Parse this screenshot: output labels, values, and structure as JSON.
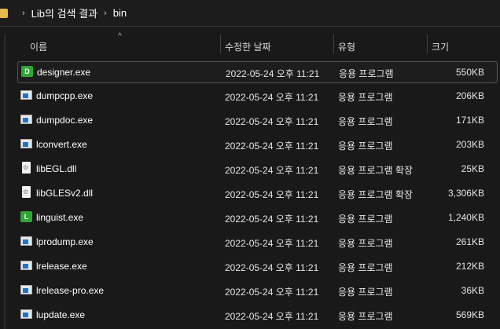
{
  "breadcrumb": [
    "Lib의 검색 결과",
    "bin"
  ],
  "columns": {
    "name": "이름",
    "date": "수정한 날짜",
    "type": "유형",
    "size": "크기"
  },
  "files": [
    {
      "name": "designer.exe",
      "icon": "qt-designer-icon",
      "letter": "D",
      "date": "2022-05-24 오후 11:21",
      "type": "응용 프로그램",
      "size": "550KB"
    },
    {
      "name": "dumpcpp.exe",
      "icon": "exe-icon",
      "date": "2022-05-24 오후 11:21",
      "type": "응용 프로그램",
      "size": "206KB"
    },
    {
      "name": "dumpdoc.exe",
      "icon": "exe-icon",
      "date": "2022-05-24 오후 11:21",
      "type": "응용 프로그램",
      "size": "171KB"
    },
    {
      "name": "lconvert.exe",
      "icon": "exe-icon",
      "date": "2022-05-24 오후 11:21",
      "type": "응용 프로그램",
      "size": "203KB"
    },
    {
      "name": "libEGL.dll",
      "icon": "dll-icon",
      "date": "2022-05-24 오후 11:21",
      "type": "응용 프로그램 확장",
      "size": "25KB"
    },
    {
      "name": "libGLESv2.dll",
      "icon": "dll-icon",
      "date": "2022-05-24 오후 11:21",
      "type": "응용 프로그램 확장",
      "size": "3,306KB"
    },
    {
      "name": "linguist.exe",
      "icon": "qt-linguist-icon",
      "letter": "L",
      "date": "2022-05-24 오후 11:21",
      "type": "응용 프로그램",
      "size": "1,240KB"
    },
    {
      "name": "lprodump.exe",
      "icon": "exe-icon",
      "date": "2022-05-24 오후 11:21",
      "type": "응용 프로그램",
      "size": "261KB"
    },
    {
      "name": "lrelease.exe",
      "icon": "exe-icon",
      "date": "2022-05-24 오후 11:21",
      "type": "응용 프로그램",
      "size": "212KB"
    },
    {
      "name": "lrelease-pro.exe",
      "icon": "exe-icon",
      "date": "2022-05-24 오후 11:21",
      "type": "응용 프로그램",
      "size": "36KB"
    },
    {
      "name": "lupdate.exe",
      "icon": "exe-icon",
      "date": "2022-05-24 오후 11:21",
      "type": "응용 프로그램",
      "size": "569KB"
    }
  ]
}
